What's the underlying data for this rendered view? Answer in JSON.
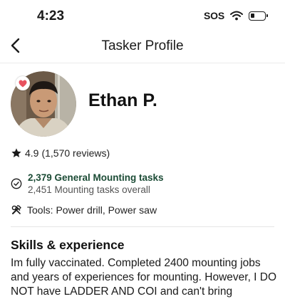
{
  "status_bar": {
    "time": "4:23",
    "sos": "SOS",
    "icons": [
      "wifi-icon",
      "battery-icon"
    ]
  },
  "header": {
    "back_icon": "chevron-left-icon",
    "title": "Tasker Profile"
  },
  "profile": {
    "name": "Ethan P.",
    "favorite_icon": "heart-icon",
    "rating": "4.9",
    "reviews": "(1,570 reviews)",
    "category_tasks": "2,379 General Mounting tasks",
    "overall_tasks": "2,451 Mounting tasks overall",
    "tools": "Tools: Power drill, Power saw"
  },
  "skills": {
    "title": "Skills & experience",
    "body": "Im fully vaccinated. Completed 2400 mounting jobs and years of experiences for mounting. However, I DO NOT have LADDER AND COI and can't bring"
  },
  "colors": {
    "accent_green": "#1b4b35",
    "heart": "#e8525f"
  }
}
